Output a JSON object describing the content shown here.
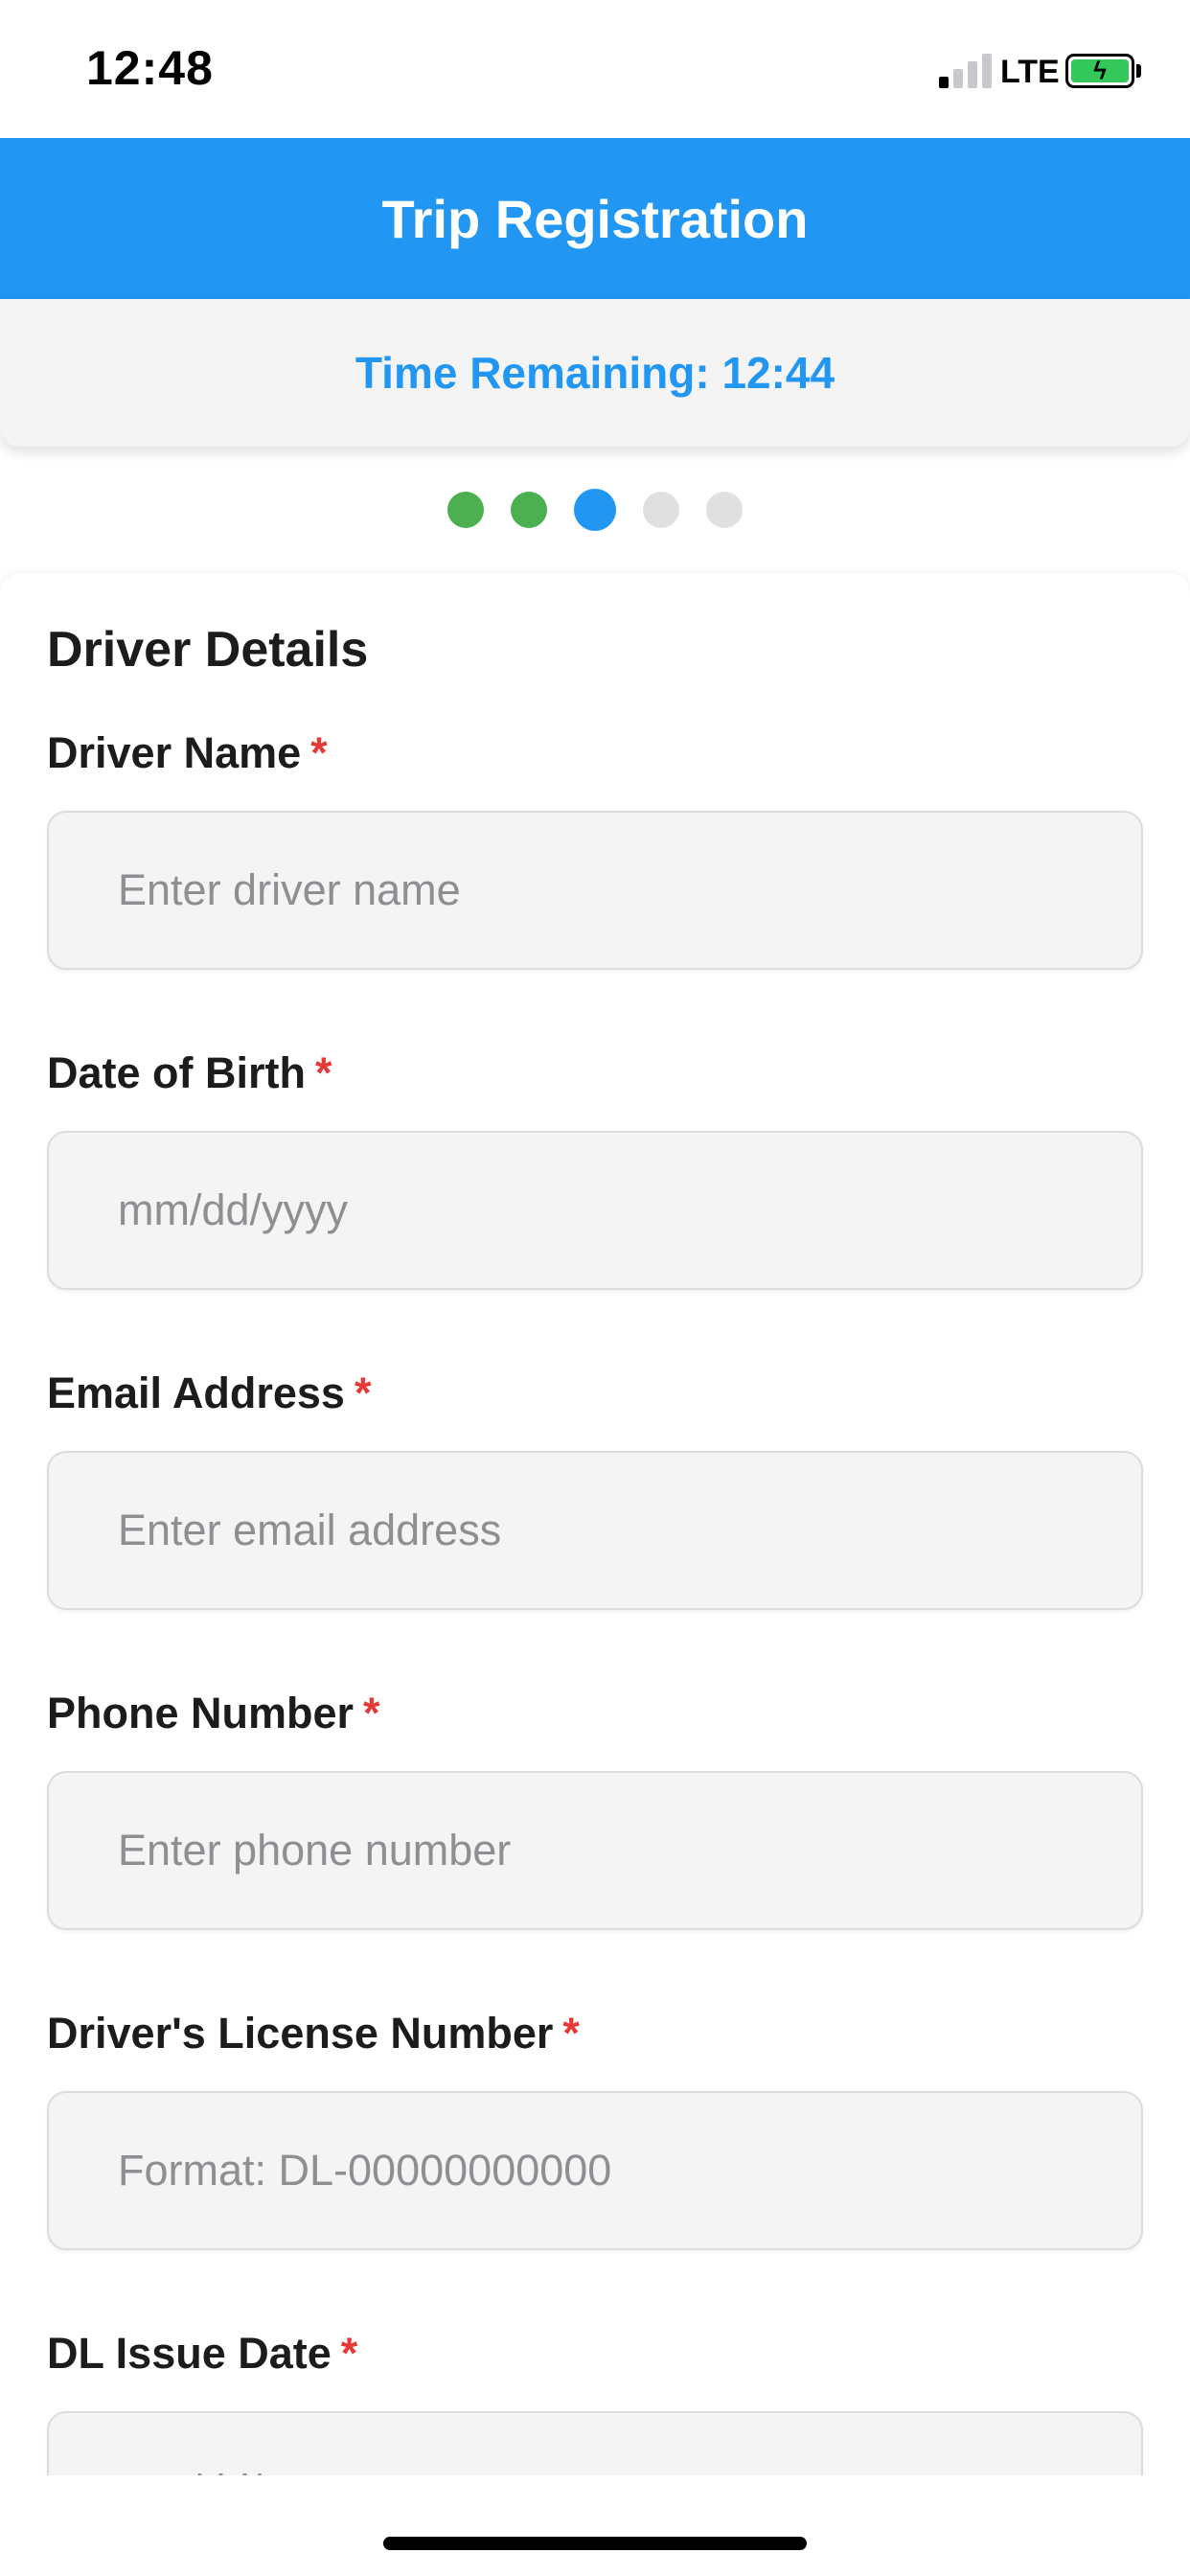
{
  "status_bar": {
    "time": "12:48",
    "network": "LTE",
    "signal_bars_active": 1,
    "signal_bars_total": 4,
    "battery_icon": "battery-charging-icon",
    "battery_color": "#34c759"
  },
  "header": {
    "title": "Trip Registration",
    "background_color": "#2196f3"
  },
  "timer": {
    "text": "Time Remaining: 12:44",
    "color": "#2196f3"
  },
  "steps": {
    "total": 5,
    "current_step": 3,
    "completed_color": "#4caf50",
    "active_color": "#2196f3",
    "pending_color": "#e0e0e0"
  },
  "form": {
    "section_title": "Driver Details",
    "required_marker": "*",
    "fields": [
      {
        "label": "Driver Name",
        "placeholder": "Enter driver name",
        "value": ""
      },
      {
        "label": "Date of Birth",
        "placeholder": "mm/dd/yyyy",
        "value": ""
      },
      {
        "label": "Email Address",
        "placeholder": "Enter email address",
        "value": ""
      },
      {
        "label": "Phone Number",
        "placeholder": "Enter phone number",
        "value": ""
      },
      {
        "label": "Driver's License Number",
        "placeholder": "Format: DL-00000000000",
        "value": ""
      },
      {
        "label": "DL Issue Date",
        "placeholder": "mm/dd/yyyy",
        "value": ""
      }
    ]
  }
}
